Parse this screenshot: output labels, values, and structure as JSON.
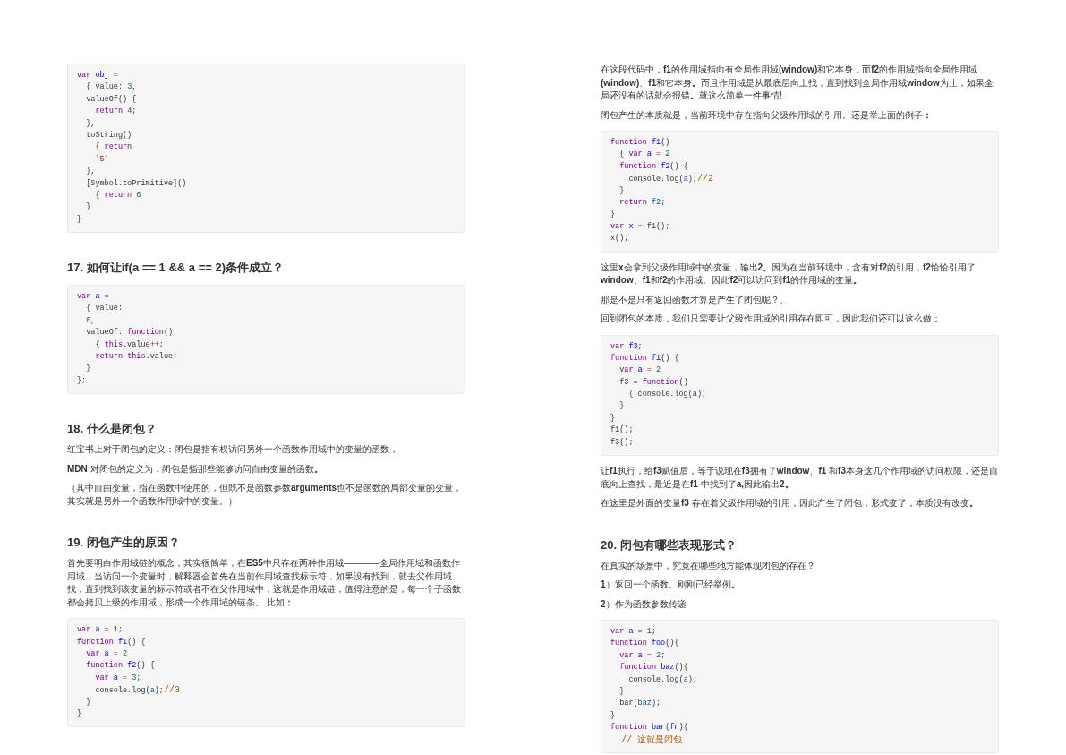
{
  "pages": [
    {
      "blocks": [
        {
          "kind": "code",
          "lines": [
            {
              "tokens": [
                {
                  "kind": "keyword",
                  "text": "var "
                },
                {
                  "kind": "def",
                  "text": "obj "
                },
                {
                  "kind": "operator",
                  "text": "="
                }
              ]
            },
            {
              "tokens": [
                {
                  "kind": "plain",
                  "text": "  { value: "
                },
                {
                  "kind": "number",
                  "text": "3"
                },
                {
                  "kind": "plain",
                  "text": ","
                }
              ]
            },
            {
              "tokens": [
                {
                  "kind": "plain",
                  "text": "  valueOf() {"
                }
              ]
            },
            {
              "tokens": [
                {
                  "kind": "keyword",
                  "text": "    return "
                },
                {
                  "kind": "number",
                  "text": "4"
                },
                {
                  "kind": "plain",
                  "text": ";"
                }
              ]
            },
            {
              "tokens": [
                {
                  "kind": "plain",
                  "text": "  },"
                }
              ]
            },
            {
              "tokens": [
                {
                  "kind": "plain",
                  "text": "  toString()"
                }
              ]
            },
            {
              "tokens": [
                {
                  "kind": "plain",
                  "text": "    { "
                },
                {
                  "kind": "keyword",
                  "text": "return"
                }
              ]
            },
            {
              "tokens": [
                {
                  "kind": "string",
                  "text": "    '5'"
                }
              ]
            },
            {
              "tokens": [
                {
                  "kind": "plain",
                  "text": "  },"
                }
              ]
            },
            {
              "tokens": [
                {
                  "kind": "plain",
                  "text": "  [Symbol.toPrimitive]()"
                }
              ]
            },
            {
              "tokens": [
                {
                  "kind": "plain",
                  "text": "    { "
                },
                {
                  "kind": "keyword",
                  "text": "return "
                },
                {
                  "kind": "number",
                  "text": "6"
                }
              ]
            },
            {
              "tokens": [
                {
                  "kind": "plain",
                  "text": "  }"
                }
              ]
            },
            {
              "tokens": [
                {
                  "kind": "plain",
                  "text": "}"
                }
              ]
            }
          ]
        },
        {
          "kind": "heading",
          "text": "17. 如何让if(a == 1 && a == 2)条件成立？"
        },
        {
          "kind": "code",
          "lines": [
            {
              "tokens": [
                {
                  "kind": "keyword",
                  "text": "var "
                },
                {
                  "kind": "def",
                  "text": "a "
                },
                {
                  "kind": "operator",
                  "text": "="
                }
              ]
            },
            {
              "tokens": [
                {
                  "kind": "plain",
                  "text": "  { value:"
                }
              ]
            },
            {
              "tokens": [
                {
                  "kind": "number",
                  "text": "  0"
                },
                {
                  "kind": "plain",
                  "text": ","
                }
              ]
            },
            {
              "tokens": [
                {
                  "kind": "plain",
                  "text": "  valueOf: "
                },
                {
                  "kind": "keyword",
                  "text": "function"
                },
                {
                  "kind": "plain",
                  "text": "()"
                }
              ]
            },
            {
              "tokens": [
                {
                  "kind": "plain",
                  "text": "    { "
                },
                {
                  "kind": "keyword",
                  "text": "this"
                },
                {
                  "kind": "plain",
                  "text": ".value"
                },
                {
                  "kind": "operator",
                  "text": "++"
                },
                {
                  "kind": "plain",
                  "text": ";"
                }
              ]
            },
            {
              "tokens": [
                {
                  "kind": "keyword",
                  "text": "    return "
                },
                {
                  "kind": "keyword",
                  "text": "this"
                },
                {
                  "kind": "plain",
                  "text": ".value;"
                }
              ]
            },
            {
              "tokens": [
                {
                  "kind": "plain",
                  "text": "  }"
                }
              ]
            },
            {
              "tokens": [
                {
                  "kind": "plain",
                  "text": "};"
                }
              ]
            }
          ]
        },
        {
          "kind": "heading",
          "text": "18. 什么是闭包？"
        },
        {
          "kind": "paragraph",
          "text": "红宝书上对于闭包的定义：闭包是指有权访问另外一个函数作用域中的变量的函数，"
        },
        {
          "kind": "paragraph",
          "text": "**MDN** 对闭包的定义为：闭包是指那些能够访问自由变量的函数**。**"
        },
        {
          "kind": "paragraph",
          "text": "（其中自由变量，指在函数中使用的，但既不是函数参数**arguments**也不是函数的局部变量的变量，其实就是另外一个函数作用域中的变量。）"
        },
        {
          "kind": "heading",
          "text": "19. 闭包产生的原因？"
        },
        {
          "kind": "paragraph",
          "text": "首先要明白作用域链的概念，其实很简单，在**ES5**中只存在两种作用域————全局作用域和函数作用域，当访问一个变量时，解释器会首先在当前作用域查找标示符，如果没有找到，就去父作用域找，直到找到该变量的标示符或者不在父作用域中，这就是作用域链，值得注意的是，每一个子函数都会拷贝上级的作用域，形成一个作用域的链条。 比如**：**"
        },
        {
          "kind": "code",
          "lines": [
            {
              "tokens": [
                {
                  "kind": "keyword",
                  "text": "var "
                },
                {
                  "kind": "def",
                  "text": "a "
                },
                {
                  "kind": "operator",
                  "text": "= "
                },
                {
                  "kind": "number",
                  "text": "1"
                },
                {
                  "kind": "plain",
                  "text": ";"
                }
              ]
            },
            {
              "tokens": [
                {
                  "kind": "keyword",
                  "text": "function "
                },
                {
                  "kind": "def",
                  "text": "f1"
                },
                {
                  "kind": "plain",
                  "text": "() {"
                }
              ]
            },
            {
              "tokens": [
                {
                  "kind": "keyword",
                  "text": "  var "
                },
                {
                  "kind": "def",
                  "text": "a "
                },
                {
                  "kind": "operator",
                  "text": "= "
                },
                {
                  "kind": "number",
                  "text": "2"
                }
              ]
            },
            {
              "tokens": [
                {
                  "kind": "keyword",
                  "text": "  function "
                },
                {
                  "kind": "def",
                  "text": "f2"
                },
                {
                  "kind": "plain",
                  "text": "() {"
                }
              ]
            },
            {
              "tokens": [
                {
                  "kind": "keyword",
                  "text": "    var "
                },
                {
                  "kind": "def",
                  "text": "a "
                },
                {
                  "kind": "operator",
                  "text": "= "
                },
                {
                  "kind": "number",
                  "text": "3"
                },
                {
                  "kind": "plain",
                  "text": ";"
                }
              ]
            },
            {
              "tokens": [
                {
                  "kind": "plain",
                  "text": "    console.log("
                },
                {
                  "kind": "variable",
                  "text": "a"
                },
                {
                  "kind": "plain",
                  "text": ");"
                },
                {
                  "kind": "comment",
                  "text": "//3"
                }
              ]
            },
            {
              "tokens": [
                {
                  "kind": "plain",
                  "text": "  }"
                }
              ]
            },
            {
              "tokens": [
                {
                  "kind": "plain",
                  "text": "}"
                }
              ]
            }
          ]
        }
      ]
    },
    {
      "blocks": [
        {
          "kind": "paragraph",
          "text": "在这段代码中，**f1**的作用域指向有全局作用域**(window)**和它本身，而**f2**的作用域指向全局作用域**(window)**、**f1**和它本身**。**而且作用域是从最底层向上找，直到找到全局作用域**window**为止，如果全局还没有的话就会报错**。**就这么简单一件事情!"
        },
        {
          "kind": "paragraph",
          "text": "闭包产生的本质就是，当前环境中存在指向父级作用域的引用。还是举上面的例子**：**"
        },
        {
          "kind": "code",
          "lines": [
            {
              "tokens": [
                {
                  "kind": "keyword",
                  "text": "function "
                },
                {
                  "kind": "def",
                  "text": "f1"
                },
                {
                  "kind": "plain",
                  "text": "()"
                }
              ]
            },
            {
              "tokens": [
                {
                  "kind": "plain",
                  "text": "  { "
                },
                {
                  "kind": "keyword",
                  "text": "var "
                },
                {
                  "kind": "def",
                  "text": "a "
                },
                {
                  "kind": "operator",
                  "text": "= "
                },
                {
                  "kind": "number",
                  "text": "2"
                }
              ]
            },
            {
              "tokens": [
                {
                  "kind": "keyword",
                  "text": "  function "
                },
                {
                  "kind": "def",
                  "text": "f2"
                },
                {
                  "kind": "plain",
                  "text": "() {"
                }
              ]
            },
            {
              "tokens": [
                {
                  "kind": "plain",
                  "text": "    console.log("
                },
                {
                  "kind": "variable",
                  "text": "a"
                },
                {
                  "kind": "plain",
                  "text": ");"
                },
                {
                  "kind": "comment",
                  "text": "//2"
                }
              ]
            },
            {
              "tokens": [
                {
                  "kind": "plain",
                  "text": "  }"
                }
              ]
            },
            {
              "tokens": [
                {
                  "kind": "keyword",
                  "text": "  return "
                },
                {
                  "kind": "variable",
                  "text": "f2"
                },
                {
                  "kind": "plain",
                  "text": ";"
                }
              ]
            },
            {
              "tokens": [
                {
                  "kind": "plain",
                  "text": "}"
                }
              ]
            },
            {
              "tokens": [
                {
                  "kind": "keyword",
                  "text": "var "
                },
                {
                  "kind": "def",
                  "text": "x "
                },
                {
                  "kind": "operator",
                  "text": "= "
                },
                {
                  "kind": "plain",
                  "text": "f1();"
                }
              ]
            },
            {
              "tokens": [
                {
                  "kind": "plain",
                  "text": "x();"
                }
              ]
            }
          ]
        },
        {
          "kind": "paragraph",
          "text": "这里**x**会拿到父级作用域中的变量，输出**2。**因为在当前环境中，含有对**f2**的引用，**f2**恰恰引用了**window**、**f1**和**f2**的作用域。因此**f2**可以访问到**f1**的作用域的变量**。**"
        },
        {
          "kind": "paragraph",
          "text": "那是不是只有返回函数才算是产生了闭包呢？、"
        },
        {
          "kind": "paragraph",
          "text": "回到闭包的本质，我们只需要让父级作用域的引用存在即可，因此我们还可以这么做："
        },
        {
          "kind": "code",
          "lines": [
            {
              "tokens": [
                {
                  "kind": "keyword",
                  "text": "var "
                },
                {
                  "kind": "def",
                  "text": "f3"
                },
                {
                  "kind": "plain",
                  "text": ";"
                }
              ]
            },
            {
              "tokens": [
                {
                  "kind": "keyword",
                  "text": "function "
                },
                {
                  "kind": "def",
                  "text": "f1"
                },
                {
                  "kind": "plain",
                  "text": "() {"
                }
              ]
            },
            {
              "tokens": [
                {
                  "kind": "keyword",
                  "text": "  var "
                },
                {
                  "kind": "def",
                  "text": "a "
                },
                {
                  "kind": "operator",
                  "text": "= "
                },
                {
                  "kind": "number",
                  "text": "2"
                }
              ]
            },
            {
              "tokens": [
                {
                  "kind": "plain",
                  "text": "  f3 "
                },
                {
                  "kind": "operator",
                  "text": "= "
                },
                {
                  "kind": "keyword",
                  "text": "function"
                },
                {
                  "kind": "plain",
                  "text": "()"
                }
              ]
            },
            {
              "tokens": [
                {
                  "kind": "plain",
                  "text": "    { console.log("
                },
                {
                  "kind": "variable",
                  "text": "a"
                },
                {
                  "kind": "plain",
                  "text": ");"
                }
              ]
            },
            {
              "tokens": [
                {
                  "kind": "plain",
                  "text": "  }"
                }
              ]
            },
            {
              "tokens": [
                {
                  "kind": "plain",
                  "text": "}"
                }
              ]
            },
            {
              "tokens": [
                {
                  "kind": "plain",
                  "text": "f1();"
                }
              ]
            },
            {
              "tokens": [
                {
                  "kind": "plain",
                  "text": "f3();"
                }
              ]
            }
          ]
        },
        {
          "kind": "paragraph",
          "text": "让**f1**执行，给**f3**赋值后，等于说现在**f3**拥有了**window**、**f1** 和**f3**本身这几个作用域的访问权限，还是自底向上查找，最近是在**f1** 中找到了**a,**因此输出**2。**"
        },
        {
          "kind": "paragraph",
          "text": "在这里是外面的变量**f3** 存在着父级作用域的引用，因此产生了闭包，形式变了，本质没有改变**。**"
        },
        {
          "kind": "heading",
          "text": "20. 闭包有哪些表现形式？"
        },
        {
          "kind": "paragraph",
          "text": "在真实的场景中，究竟在哪些地方能体现闭包的存在？"
        },
        {
          "kind": "paragraph",
          "text": "**1**）返回一个函数。刚刚已经举例**。**"
        },
        {
          "kind": "paragraph",
          "text": "**2**）作为函数参数传递"
        },
        {
          "kind": "code",
          "lines": [
            {
              "tokens": [
                {
                  "kind": "keyword",
                  "text": "var "
                },
                {
                  "kind": "def",
                  "text": "a "
                },
                {
                  "kind": "operator",
                  "text": "= "
                },
                {
                  "kind": "number",
                  "text": "1"
                },
                {
                  "kind": "plain",
                  "text": ";"
                }
              ]
            },
            {
              "tokens": [
                {
                  "kind": "keyword",
                  "text": "function "
                },
                {
                  "kind": "def",
                  "text": "foo"
                },
                {
                  "kind": "plain",
                  "text": "(){"
                }
              ]
            },
            {
              "tokens": [
                {
                  "kind": "keyword",
                  "text": "  var "
                },
                {
                  "kind": "def",
                  "text": "a "
                },
                {
                  "kind": "operator",
                  "text": "= "
                },
                {
                  "kind": "number",
                  "text": "2"
                },
                {
                  "kind": "plain",
                  "text": ";"
                }
              ]
            },
            {
              "tokens": [
                {
                  "kind": "keyword",
                  "text": "  function "
                },
                {
                  "kind": "def",
                  "text": "baz"
                },
                {
                  "kind": "plain",
                  "text": "(){"
                }
              ]
            },
            {
              "tokens": [
                {
                  "kind": "plain",
                  "text": "    console.log("
                },
                {
                  "kind": "variable",
                  "text": "a"
                },
                {
                  "kind": "plain",
                  "text": ");"
                }
              ]
            },
            {
              "tokens": [
                {
                  "kind": "plain",
                  "text": "  }"
                }
              ]
            },
            {
              "tokens": [
                {
                  "kind": "plain",
                  "text": "  bar("
                },
                {
                  "kind": "variable",
                  "text": "baz"
                },
                {
                  "kind": "plain",
                  "text": ");"
                }
              ]
            },
            {
              "tokens": [
                {
                  "kind": "plain",
                  "text": "}"
                }
              ]
            },
            {
              "tokens": [
                {
                  "kind": "keyword",
                  "text": "function "
                },
                {
                  "kind": "def",
                  "text": "bar"
                },
                {
                  "kind": "plain",
                  "text": "("
                },
                {
                  "kind": "def",
                  "text": "fn"
                },
                {
                  "kind": "plain",
                  "text": "){"
                }
              ]
            },
            {
              "tokens": [
                {
                  "kind": "comment",
                  "text": "  // 这就是闭包"
                }
              ]
            }
          ]
        }
      ]
    }
  ]
}
